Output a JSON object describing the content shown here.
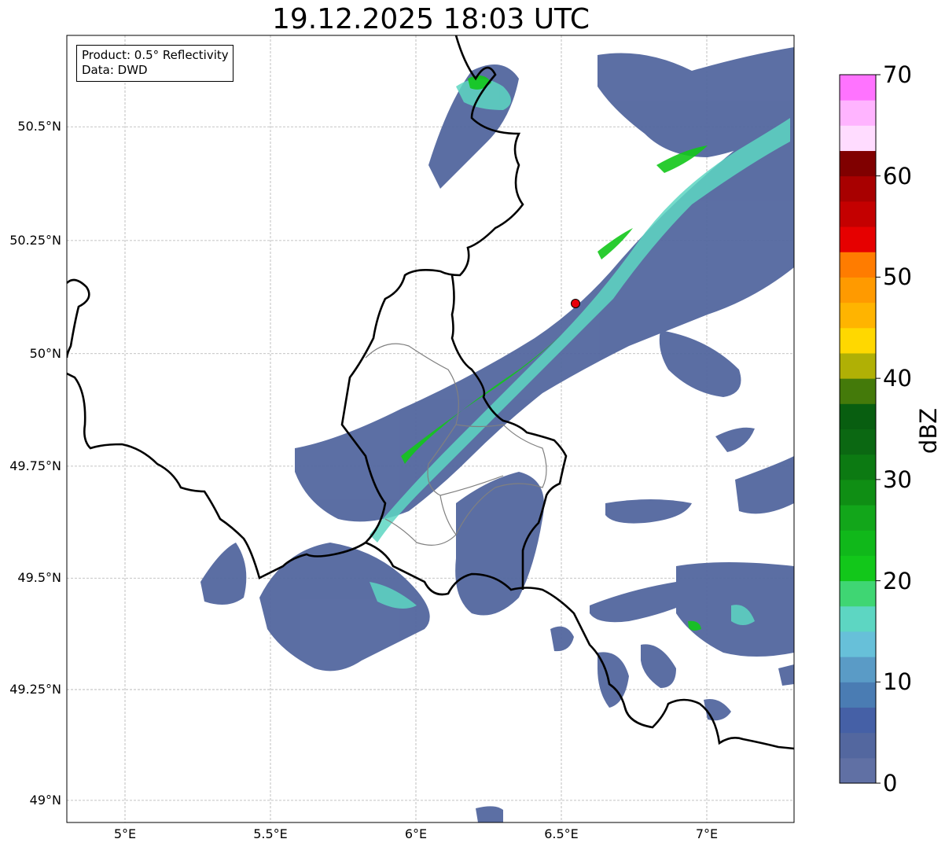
{
  "title": "19.12.2025 18:03 UTC",
  "info_box": {
    "line1": "Product: 0.5° Reflectivity",
    "line2": "Data: DWD"
  },
  "map": {
    "extent": {
      "lon_min": 4.8,
      "lon_max": 7.3,
      "lat_min": 48.95,
      "lat_max": 50.7
    },
    "lat_ticks": [
      {
        "value": 50.5,
        "label": "50.5°N"
      },
      {
        "value": 50.25,
        "label": "50.25°N"
      },
      {
        "value": 50.0,
        "label": "50°N"
      },
      {
        "value": 49.75,
        "label": "49.75°N"
      },
      {
        "value": 49.5,
        "label": "49.5°N"
      },
      {
        "value": 49.25,
        "label": "49.25°N"
      },
      {
        "value": 49.0,
        "label": "49°N"
      }
    ],
    "lon_ticks": [
      {
        "value": 5.0,
        "label": "5°E"
      },
      {
        "value": 5.5,
        "label": "5.5°E"
      },
      {
        "value": 6.0,
        "label": "6°E"
      },
      {
        "value": 6.5,
        "label": "6.5°E"
      },
      {
        "value": 7.0,
        "label": "7°E"
      }
    ],
    "radar_site": {
      "lon": 6.55,
      "lat": 50.11,
      "color": "#e8000b"
    },
    "grid": true
  },
  "colorbar": {
    "unit": "dBZ",
    "min": 0,
    "max": 70,
    "step": 2.5,
    "ticks": [
      {
        "value": 0,
        "label": "0"
      },
      {
        "value": 10,
        "label": "10"
      },
      {
        "value": 20,
        "label": "20"
      },
      {
        "value": 30,
        "label": "30"
      },
      {
        "value": 40,
        "label": "40"
      },
      {
        "value": 50,
        "label": "50"
      },
      {
        "value": 60,
        "label": "60"
      },
      {
        "value": 70,
        "label": "70"
      }
    ],
    "colors": [
      "#6070a4",
      "#53679f",
      "#4560a6",
      "#4a7cb3",
      "#5a9bc6",
      "#67c0d9",
      "#5dd6c2",
      "#3fd673",
      "#12c71a",
      "#10b81a",
      "#12a61a",
      "#0f8e14",
      "#0c7a12",
      "#0b6812",
      "#085e10",
      "#447a0a",
      "#b0b005",
      "#ffd800",
      "#ffb400",
      "#ff9a00",
      "#ff7c00",
      "#e60000",
      "#c40000",
      "#a80000",
      "#800000",
      "#ffdcff",
      "#ffb4ff",
      "#ff73ff",
      "#e63cf0"
    ]
  }
}
